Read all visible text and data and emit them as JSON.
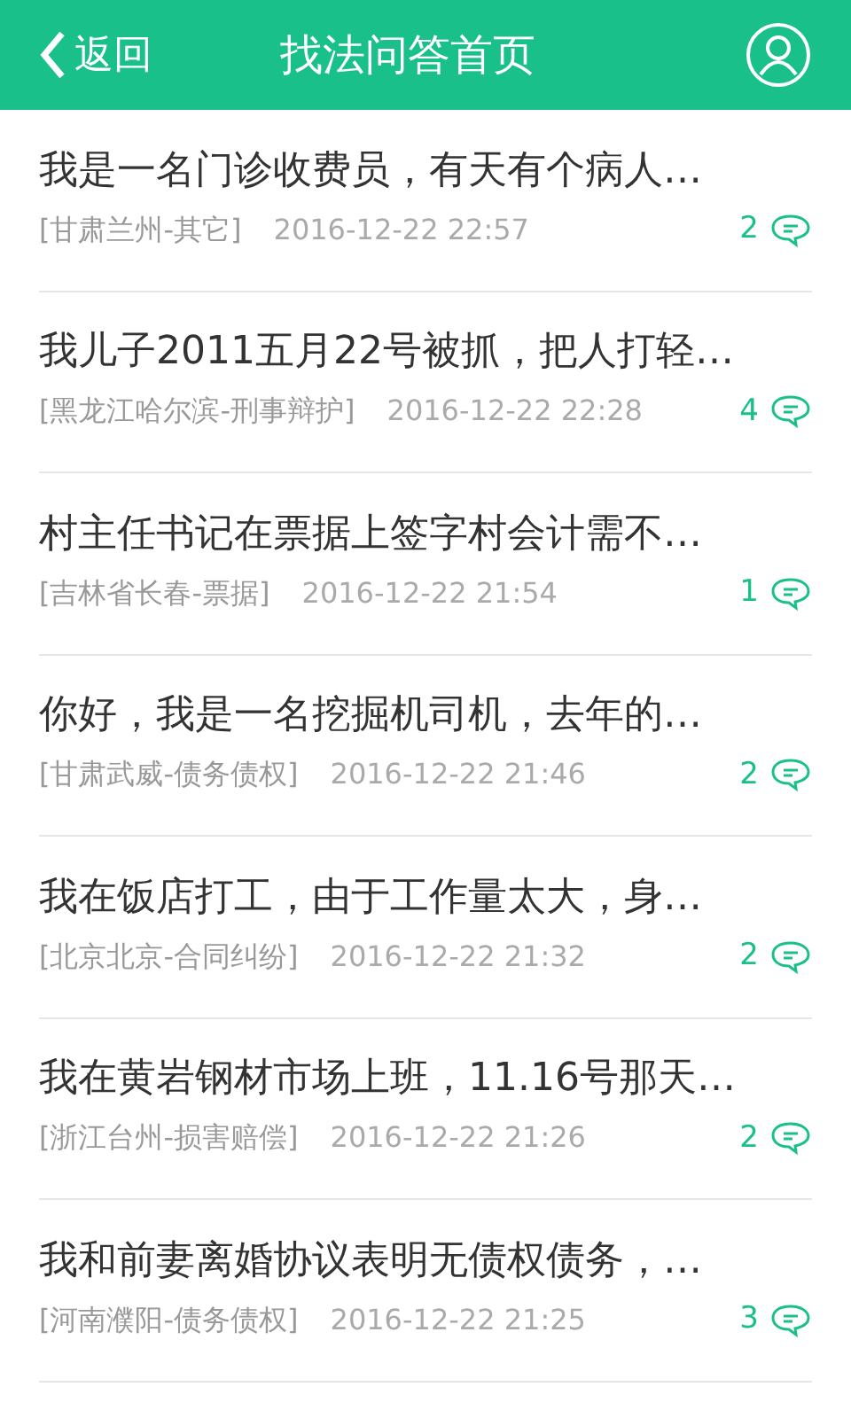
{
  "header": {
    "back": "返回",
    "title": "找法问答首页"
  },
  "questions": [
    {
      "title": "我是一名门诊收费员，有天有个病人…",
      "tag": "[甘肃兰州-其它]",
      "time": "2016-12-22 22:57",
      "answers": "2"
    },
    {
      "title": "我儿子2011五月22号被抓，把人打轻…",
      "tag": "[黑龙江哈尔滨-刑事辩护]",
      "time": "2016-12-22 22:28",
      "answers": "4"
    },
    {
      "title": "村主任书记在票据上签字村会计需不…",
      "tag": "[吉林省长春-票据]",
      "time": "2016-12-22 21:54",
      "answers": "1"
    },
    {
      "title": "你好，我是一名挖掘机司机，去年的…",
      "tag": "[甘肃武威-债务债权]",
      "time": "2016-12-22 21:46",
      "answers": "2"
    },
    {
      "title": "我在饭店打工，由于工作量太大，身…",
      "tag": "[北京北京-合同纠纷]",
      "time": "2016-12-22 21:32",
      "answers": "2"
    },
    {
      "title": "我在黄岩钢材市场上班，11.16号那天…",
      "tag": "[浙江台州-损害赔偿]",
      "time": "2016-12-22 21:26",
      "answers": "2"
    },
    {
      "title": "我和前妻离婚协议表明无债权债务，…",
      "tag": "[河南濮阳-债务债权]",
      "time": "2016-12-22 21:25",
      "answers": "3"
    }
  ]
}
